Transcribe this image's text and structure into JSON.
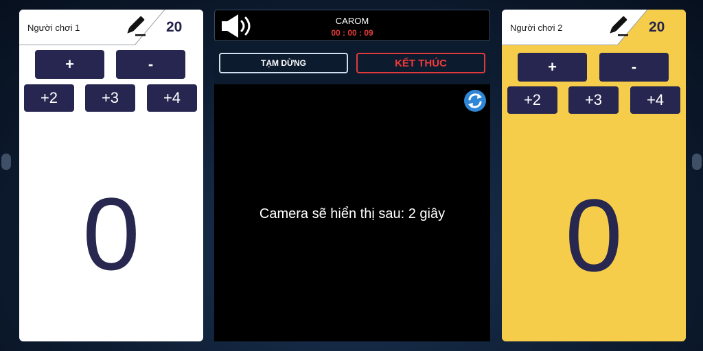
{
  "players": [
    {
      "name": "Người chơi 1",
      "target": "20",
      "score": "0",
      "increment_buttons": [
        "+",
        "-"
      ],
      "bonus_buttons": [
        "+2",
        "+3",
        "+4"
      ],
      "background": "#ffffff",
      "edit_icon": "pencil-icon"
    },
    {
      "name": "Người chơi 2",
      "target": "20",
      "score": "0",
      "increment_buttons": [
        "+",
        "-"
      ],
      "bonus_buttons": [
        "+2",
        "+3",
        "+4"
      ],
      "background": "#f6cd4a",
      "edit_icon": "pencil-icon"
    }
  ],
  "game": {
    "name": "CAROM",
    "timer": "00 : 00 : 09",
    "pause_label": "TẠM DỪNG",
    "end_label": "KẾT THÚC",
    "camera_message": "Camera sẽ hiển thị sau: 2 giây",
    "sound_icon": "speaker-icon",
    "refresh_icon": "refresh-icon"
  },
  "colors": {
    "button": "#262650",
    "score_text": "#272750",
    "timer": "#e23a3a",
    "end_button": "#e23a3a",
    "player2_panel": "#f6cd4a"
  }
}
